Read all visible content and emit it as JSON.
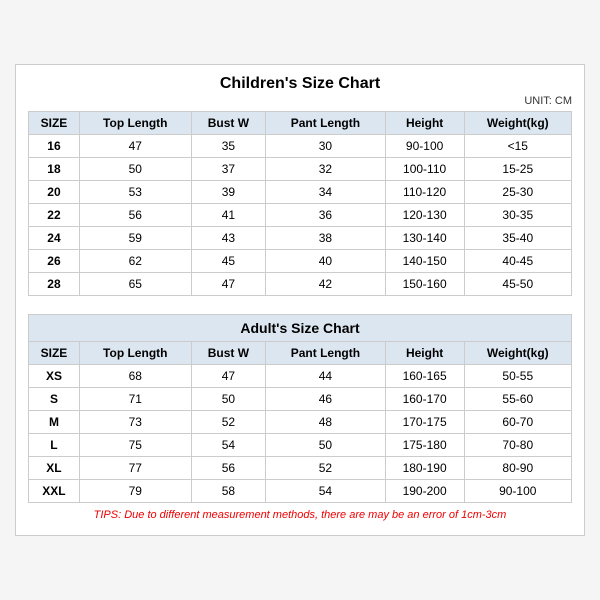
{
  "title": "Children's Size Chart",
  "unit": "UNIT: CM",
  "children": {
    "columns": [
      "SIZE",
      "Top Length",
      "Bust W",
      "Pant Length",
      "Height",
      "Weight(kg)"
    ],
    "rows": [
      [
        "16",
        "47",
        "35",
        "30",
        "90-100",
        "<15"
      ],
      [
        "18",
        "50",
        "37",
        "32",
        "100-110",
        "15-25"
      ],
      [
        "20",
        "53",
        "39",
        "34",
        "110-120",
        "25-30"
      ],
      [
        "22",
        "56",
        "41",
        "36",
        "120-130",
        "30-35"
      ],
      [
        "24",
        "59",
        "43",
        "38",
        "130-140",
        "35-40"
      ],
      [
        "26",
        "62",
        "45",
        "40",
        "140-150",
        "40-45"
      ],
      [
        "28",
        "65",
        "47",
        "42",
        "150-160",
        "45-50"
      ]
    ]
  },
  "adults": {
    "title": "Adult's Size Chart",
    "columns": [
      "SIZE",
      "Top Length",
      "Bust W",
      "Pant Length",
      "Height",
      "Weight(kg)"
    ],
    "rows": [
      [
        "XS",
        "68",
        "47",
        "44",
        "160-165",
        "50-55"
      ],
      [
        "S",
        "71",
        "50",
        "46",
        "160-170",
        "55-60"
      ],
      [
        "M",
        "73",
        "52",
        "48",
        "170-175",
        "60-70"
      ],
      [
        "L",
        "75",
        "54",
        "50",
        "175-180",
        "70-80"
      ],
      [
        "XL",
        "77",
        "56",
        "52",
        "180-190",
        "80-90"
      ],
      [
        "XXL",
        "79",
        "58",
        "54",
        "190-200",
        "90-100"
      ]
    ]
  },
  "tips": "TIPS: Due to different measurement methods, there are may be an error of 1cm-3cm"
}
